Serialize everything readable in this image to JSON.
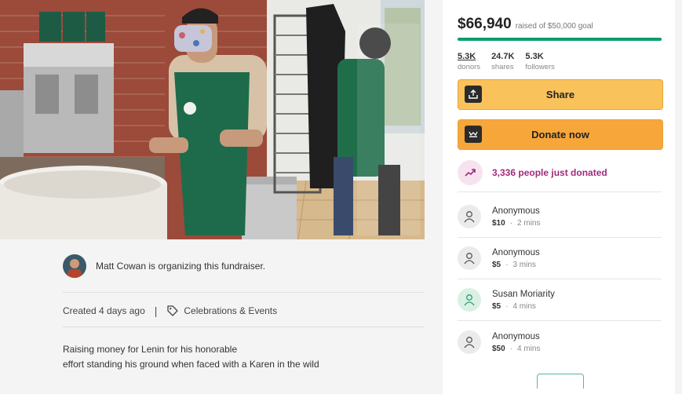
{
  "fundraiser": {
    "organizer_text": "Matt Cowan is organizing this fundraiser.",
    "created": "Created 4 days ago",
    "separator": "|",
    "category": "Celebrations & Events",
    "story_line1": "Raising money for Lenin for his honorable",
    "story_line2": "effort standing his ground when faced with a Karen in the wild"
  },
  "sidebar": {
    "amount": "$66,940",
    "goal_text": "raised of $50,000 goal",
    "progress_fraction": 1.0,
    "stats": [
      {
        "value": "5.3K",
        "label": "donors"
      },
      {
        "value": "24.7K",
        "label": "shares"
      },
      {
        "value": "5.3K",
        "label": "followers"
      }
    ],
    "share_label": "Share",
    "donate_label": "Donate now",
    "recent_text": "3,336 people just donated",
    "donations": [
      {
        "name": "Anonymous",
        "amount": "$10",
        "time": "2 mins"
      },
      {
        "name": "Anonymous",
        "amount": "$5",
        "time": "3 mins"
      },
      {
        "name": "Susan Moriarity",
        "amount": "$5",
        "time": "4 mins"
      },
      {
        "name": "Anonymous",
        "amount": "$50",
        "time": "4 mins"
      }
    ],
    "dot": "·"
  },
  "colors": {
    "progress": "#0e9c6b",
    "share_button": "#f9c25b",
    "donate_button": "#f7a63a",
    "recent_text": "#a12a7c"
  },
  "icons": {
    "share": "upload-icon",
    "donate": "gofundme-logo-icon",
    "recent": "trending-up-icon",
    "donor": "user-heart-icon",
    "category": "tag-icon"
  }
}
